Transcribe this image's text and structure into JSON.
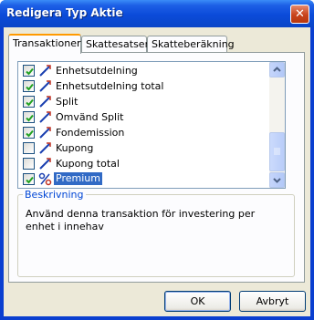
{
  "window": {
    "title": "Redigera Typ Aktie",
    "close_glyph": "✕"
  },
  "tabs": [
    {
      "label": "Transaktioner",
      "active": true
    },
    {
      "label": "Skattesatser",
      "active": false
    },
    {
      "label": "Skatteberäkning",
      "active": false
    }
  ],
  "list": {
    "items": [
      {
        "label": "Enhetsutdelning",
        "checked": true,
        "icon": "split-line-icon"
      },
      {
        "label": "Enhetsutdelning total",
        "checked": true,
        "icon": "split-line-icon"
      },
      {
        "label": "Split",
        "checked": true,
        "icon": "split-line-icon"
      },
      {
        "label": "Omvänd Split",
        "checked": true,
        "icon": "split-line-icon"
      },
      {
        "label": "Fondemission",
        "checked": true,
        "icon": "split-line-icon"
      },
      {
        "label": "Kupong",
        "checked": false,
        "icon": "split-line-icon"
      },
      {
        "label": "Kupong total",
        "checked": false,
        "icon": "split-line-icon"
      },
      {
        "label": "Premium",
        "checked": true,
        "icon": "percent-icon",
        "selected": true
      }
    ]
  },
  "description": {
    "title": "Beskrivning",
    "text": "Använd denna transaktion för investering per enhet i innehav"
  },
  "buttons": {
    "ok": "OK",
    "cancel": "Avbryt"
  },
  "colors": {
    "selection": "#316ac5",
    "titlebar": "#0b4bd9",
    "group_title": "#0046d5"
  }
}
